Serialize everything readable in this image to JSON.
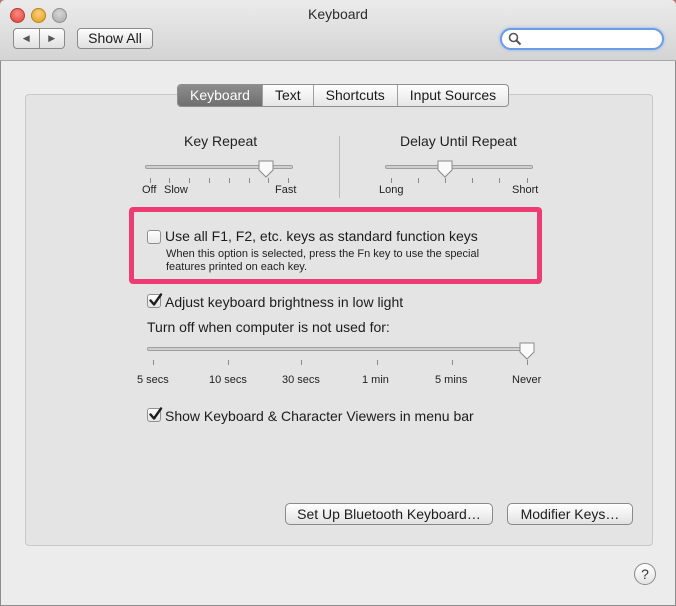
{
  "window": {
    "title": "Keyboard"
  },
  "toolbar": {
    "back_label": "◀",
    "forward_label": "▶",
    "show_all_label": "Show All",
    "search_placeholder": ""
  },
  "tabs": [
    {
      "label": "Keyboard",
      "active": true
    },
    {
      "label": "Text",
      "active": false
    },
    {
      "label": "Shortcuts",
      "active": false
    },
    {
      "label": "Input Sources",
      "active": false
    }
  ],
  "key_repeat": {
    "title": "Key Repeat",
    "labels": {
      "off": "Off",
      "slow": "Slow",
      "fast": "Fast"
    },
    "value": 0.78
  },
  "delay_until_repeat": {
    "title": "Delay Until Repeat",
    "labels": {
      "long": "Long",
      "short": "Short"
    },
    "value": 0.4
  },
  "function_keys": {
    "label": "Use all F1, F2, etc. keys as standard function keys",
    "checked": false,
    "description_line1": "When this option is selected, press the Fn key to use the special",
    "description_line2": "features printed on each key."
  },
  "brightness": {
    "label": "Adjust keyboard brightness in low light",
    "checked": true,
    "turn_off_label": "Turn off when computer is not used for:",
    "ticks": [
      "5 secs",
      "10 secs",
      "30 secs",
      "1 min",
      "5 mins",
      "Never"
    ],
    "value": "Never"
  },
  "viewers": {
    "label": "Show Keyboard & Character Viewers in menu bar",
    "checked": true
  },
  "buttons": {
    "bluetooth": "Set Up Bluetooth Keyboard…",
    "modifier": "Modifier Keys…",
    "help": "?"
  },
  "colors": {
    "highlight": "#ef3b74",
    "search_focus": "#6b9ce6"
  }
}
